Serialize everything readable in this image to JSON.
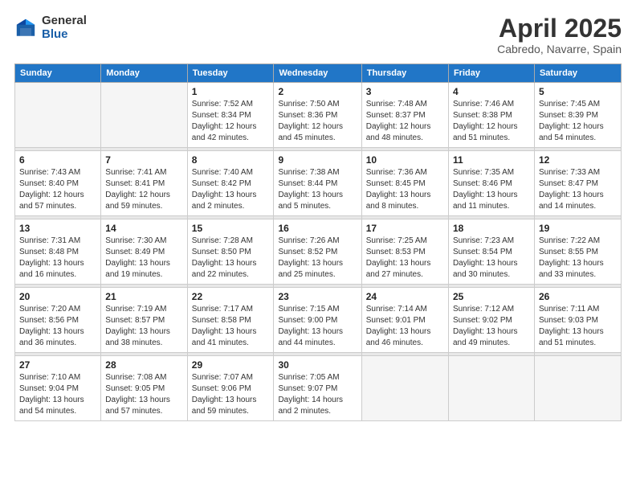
{
  "header": {
    "logo_general": "General",
    "logo_blue": "Blue",
    "title": "April 2025",
    "subtitle": "Cabredo, Navarre, Spain"
  },
  "weekdays": [
    "Sunday",
    "Monday",
    "Tuesday",
    "Wednesday",
    "Thursday",
    "Friday",
    "Saturday"
  ],
  "weeks": [
    [
      {
        "day": "",
        "info": "",
        "empty": true
      },
      {
        "day": "",
        "info": "",
        "empty": true
      },
      {
        "day": "1",
        "info": "Sunrise: 7:52 AM\nSunset: 8:34 PM\nDaylight: 12 hours and 42 minutes."
      },
      {
        "day": "2",
        "info": "Sunrise: 7:50 AM\nSunset: 8:36 PM\nDaylight: 12 hours and 45 minutes."
      },
      {
        "day": "3",
        "info": "Sunrise: 7:48 AM\nSunset: 8:37 PM\nDaylight: 12 hours and 48 minutes."
      },
      {
        "day": "4",
        "info": "Sunrise: 7:46 AM\nSunset: 8:38 PM\nDaylight: 12 hours and 51 minutes."
      },
      {
        "day": "5",
        "info": "Sunrise: 7:45 AM\nSunset: 8:39 PM\nDaylight: 12 hours and 54 minutes."
      }
    ],
    [
      {
        "day": "6",
        "info": "Sunrise: 7:43 AM\nSunset: 8:40 PM\nDaylight: 12 hours and 57 minutes."
      },
      {
        "day": "7",
        "info": "Sunrise: 7:41 AM\nSunset: 8:41 PM\nDaylight: 12 hours and 59 minutes."
      },
      {
        "day": "8",
        "info": "Sunrise: 7:40 AM\nSunset: 8:42 PM\nDaylight: 13 hours and 2 minutes."
      },
      {
        "day": "9",
        "info": "Sunrise: 7:38 AM\nSunset: 8:44 PM\nDaylight: 13 hours and 5 minutes."
      },
      {
        "day": "10",
        "info": "Sunrise: 7:36 AM\nSunset: 8:45 PM\nDaylight: 13 hours and 8 minutes."
      },
      {
        "day": "11",
        "info": "Sunrise: 7:35 AM\nSunset: 8:46 PM\nDaylight: 13 hours and 11 minutes."
      },
      {
        "day": "12",
        "info": "Sunrise: 7:33 AM\nSunset: 8:47 PM\nDaylight: 13 hours and 14 minutes."
      }
    ],
    [
      {
        "day": "13",
        "info": "Sunrise: 7:31 AM\nSunset: 8:48 PM\nDaylight: 13 hours and 16 minutes."
      },
      {
        "day": "14",
        "info": "Sunrise: 7:30 AM\nSunset: 8:49 PM\nDaylight: 13 hours and 19 minutes."
      },
      {
        "day": "15",
        "info": "Sunrise: 7:28 AM\nSunset: 8:50 PM\nDaylight: 13 hours and 22 minutes."
      },
      {
        "day": "16",
        "info": "Sunrise: 7:26 AM\nSunset: 8:52 PM\nDaylight: 13 hours and 25 minutes."
      },
      {
        "day": "17",
        "info": "Sunrise: 7:25 AM\nSunset: 8:53 PM\nDaylight: 13 hours and 27 minutes."
      },
      {
        "day": "18",
        "info": "Sunrise: 7:23 AM\nSunset: 8:54 PM\nDaylight: 13 hours and 30 minutes."
      },
      {
        "day": "19",
        "info": "Sunrise: 7:22 AM\nSunset: 8:55 PM\nDaylight: 13 hours and 33 minutes."
      }
    ],
    [
      {
        "day": "20",
        "info": "Sunrise: 7:20 AM\nSunset: 8:56 PM\nDaylight: 13 hours and 36 minutes."
      },
      {
        "day": "21",
        "info": "Sunrise: 7:19 AM\nSunset: 8:57 PM\nDaylight: 13 hours and 38 minutes."
      },
      {
        "day": "22",
        "info": "Sunrise: 7:17 AM\nSunset: 8:58 PM\nDaylight: 13 hours and 41 minutes."
      },
      {
        "day": "23",
        "info": "Sunrise: 7:15 AM\nSunset: 9:00 PM\nDaylight: 13 hours and 44 minutes."
      },
      {
        "day": "24",
        "info": "Sunrise: 7:14 AM\nSunset: 9:01 PM\nDaylight: 13 hours and 46 minutes."
      },
      {
        "day": "25",
        "info": "Sunrise: 7:12 AM\nSunset: 9:02 PM\nDaylight: 13 hours and 49 minutes."
      },
      {
        "day": "26",
        "info": "Sunrise: 7:11 AM\nSunset: 9:03 PM\nDaylight: 13 hours and 51 minutes."
      }
    ],
    [
      {
        "day": "27",
        "info": "Sunrise: 7:10 AM\nSunset: 9:04 PM\nDaylight: 13 hours and 54 minutes."
      },
      {
        "day": "28",
        "info": "Sunrise: 7:08 AM\nSunset: 9:05 PM\nDaylight: 13 hours and 57 minutes."
      },
      {
        "day": "29",
        "info": "Sunrise: 7:07 AM\nSunset: 9:06 PM\nDaylight: 13 hours and 59 minutes."
      },
      {
        "day": "30",
        "info": "Sunrise: 7:05 AM\nSunset: 9:07 PM\nDaylight: 14 hours and 2 minutes."
      },
      {
        "day": "",
        "info": "",
        "empty": true
      },
      {
        "day": "",
        "info": "",
        "empty": true
      },
      {
        "day": "",
        "info": "",
        "empty": true
      }
    ]
  ]
}
